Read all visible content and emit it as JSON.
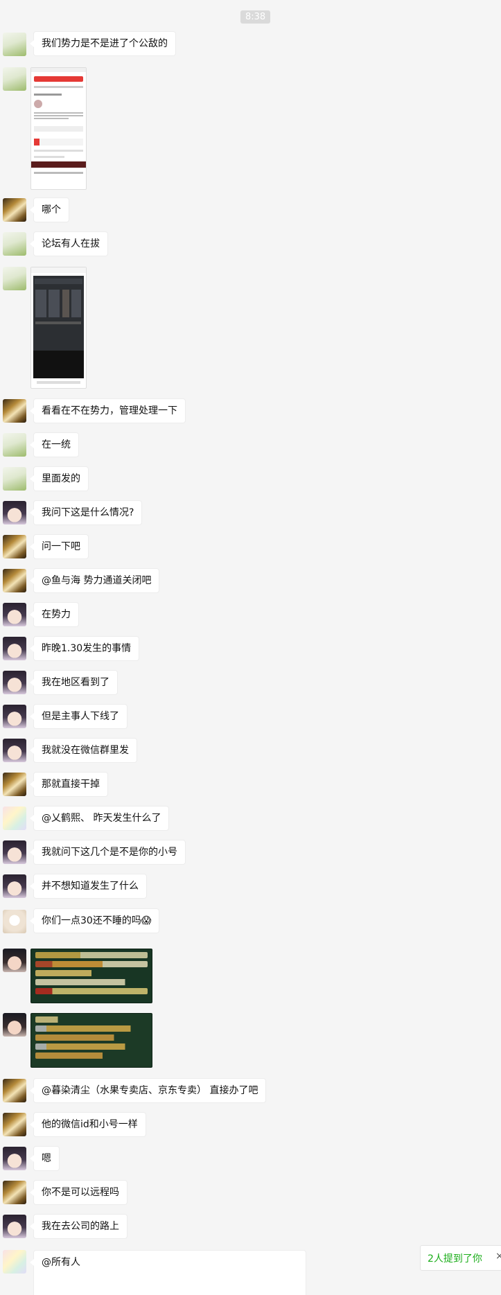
{
  "chat": {
    "timestamp": "8:38",
    "messages": [
      {
        "type": "text",
        "avatar": "green-landscape",
        "text": "我们势力是不是进了个公敌的"
      },
      {
        "type": "image",
        "avatar": "green-landscape",
        "content": "forum-screenshot"
      },
      {
        "type": "text",
        "avatar": "gold-figure",
        "text": "哪个"
      },
      {
        "type": "text",
        "avatar": "green-landscape",
        "text": "论坛有人在拔"
      },
      {
        "type": "image",
        "avatar": "green-landscape",
        "content": "game-screenshot"
      },
      {
        "type": "text",
        "avatar": "gold-figure",
        "text": "看看在不在势力，管理处理一下"
      },
      {
        "type": "text",
        "avatar": "green-landscape",
        "text": "在一统"
      },
      {
        "type": "text",
        "avatar": "green-landscape",
        "text": "里面发的"
      },
      {
        "type": "text",
        "avatar": "girl",
        "text": "我问下这是什么情况?"
      },
      {
        "type": "text",
        "avatar": "gold-figure",
        "text": "问一下吧"
      },
      {
        "type": "text",
        "avatar": "gold-figure",
        "text": "@鱼与海 势力通道关闭吧"
      },
      {
        "type": "text",
        "avatar": "girl",
        "text": "在势力"
      },
      {
        "type": "text",
        "avatar": "girl",
        "text": "昨晚1.30发生的事情"
      },
      {
        "type": "text",
        "avatar": "girl",
        "text": "我在地区看到了"
      },
      {
        "type": "text",
        "avatar": "girl",
        "text": "但是主事人下线了"
      },
      {
        "type": "text",
        "avatar": "girl",
        "text": "我就没在微信群里发"
      },
      {
        "type": "text",
        "avatar": "gold-figure",
        "text": "那就直接干掉"
      },
      {
        "type": "text",
        "avatar": "pastel",
        "text": "@乂鹤熙、 昨天发生什么了"
      },
      {
        "type": "text",
        "avatar": "girl",
        "text": "我就问下这几个是不是你的小号"
      },
      {
        "type": "text",
        "avatar": "girl",
        "text": "并不想知道发生了什么"
      },
      {
        "type": "text",
        "avatar": "cream-character",
        "text": "你们一点30还不睡的吗😱"
      },
      {
        "type": "image",
        "avatar": "girl",
        "content": "game-chat-log-1"
      },
      {
        "type": "image",
        "avatar": "girl",
        "content": "game-chat-log-2"
      },
      {
        "type": "text",
        "avatar": "gold-figure",
        "text": "@暮染清尘（水果专卖店、京东专卖） 直接办了吧"
      },
      {
        "type": "text",
        "avatar": "gold-figure",
        "text": "他的微信id和小号一样"
      },
      {
        "type": "text",
        "avatar": "girl",
        "text": "嗯"
      },
      {
        "type": "text",
        "avatar": "gold-figure",
        "text": "你不是可以远程吗"
      },
      {
        "type": "text",
        "avatar": "girl",
        "text": "我在去公司的路上"
      },
      {
        "type": "text",
        "avatar": "pastel",
        "text": "@所有人"
      }
    ]
  },
  "mention_notice": {
    "text": "2人提到了你",
    "close_glyph": "×",
    "accent": "#1aad19"
  }
}
